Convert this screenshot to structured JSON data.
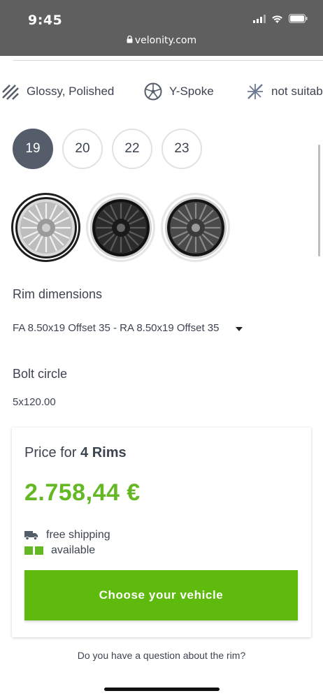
{
  "status_bar": {
    "time": "9:45",
    "url": "velonity.com"
  },
  "features": [
    {
      "icon": "stripes-icon",
      "label": "Glossy, Polished"
    },
    {
      "icon": "y-spoke-icon",
      "label": "Y-Spoke"
    },
    {
      "icon": "snowflake-crossed-icon",
      "label": "not suitab"
    }
  ],
  "sizes": [
    "19",
    "20",
    "22",
    "23"
  ],
  "selected_size": "19",
  "wheel_variants": [
    "silver-polished",
    "black-polished",
    "gunmetal-polished"
  ],
  "rim_dimensions": {
    "label": "Rim dimensions",
    "value": "FA 8.50x19 Offset 35 - RA 8.50x19 Offset 35"
  },
  "bolt_circle": {
    "label": "Bolt circle",
    "value": "5x120.00"
  },
  "price_card": {
    "label_prefix": "Price for ",
    "label_qty": "4 Rims",
    "price": "2.758,44 €",
    "shipping": "free shipping",
    "availability": "available",
    "cta": "Choose your vehicle"
  },
  "question": "Do you have a question about the rim?",
  "colors": {
    "accent_green": "#5ebb0d",
    "price_green": "#63b824",
    "selected_size": "#555d6a"
  }
}
